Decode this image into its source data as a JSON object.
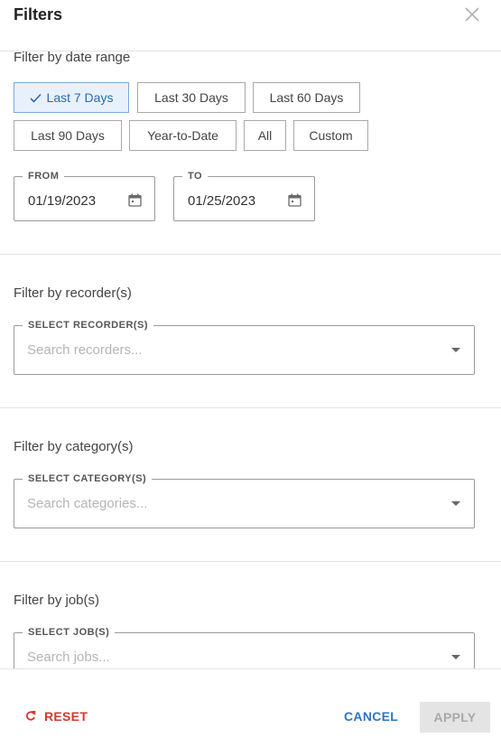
{
  "header": {
    "title": "Filters",
    "close_icon": "close-icon"
  },
  "date_section": {
    "label": "Filter by date range",
    "chips": [
      "Last 7 Days",
      "Last 30 Days",
      "Last 60 Days",
      "Last 90 Days",
      "Year-to-Date",
      "All",
      "Custom"
    ],
    "selected": "Last 7 Days",
    "from": {
      "legend": "FROM",
      "value": "01/19/2023"
    },
    "to": {
      "legend": "TO",
      "value": "01/25/2023"
    }
  },
  "recorder_section": {
    "label": "Filter by recorder(s)",
    "legend": "SELECT RECORDER(S)",
    "placeholder": "Search recorders..."
  },
  "category_section": {
    "label": "Filter by category(s)",
    "legend": "SELECT CATEGORY(S)",
    "placeholder": "Search categories..."
  },
  "job_section": {
    "label": "Filter by job(s)",
    "legend": "SELECT JOB(S)",
    "placeholder": "Search jobs..."
  },
  "footer": {
    "reset_label": "RESET",
    "cancel_label": "CANCEL",
    "apply_label": "APPLY"
  },
  "colors": {
    "selected_chip_bg": "#e8f1fb",
    "selected_chip_text": "#2a6bb0",
    "reset": "#d13a2e",
    "cancel": "#2a76c8",
    "apply_disabled_bg": "#e4e4e4"
  }
}
